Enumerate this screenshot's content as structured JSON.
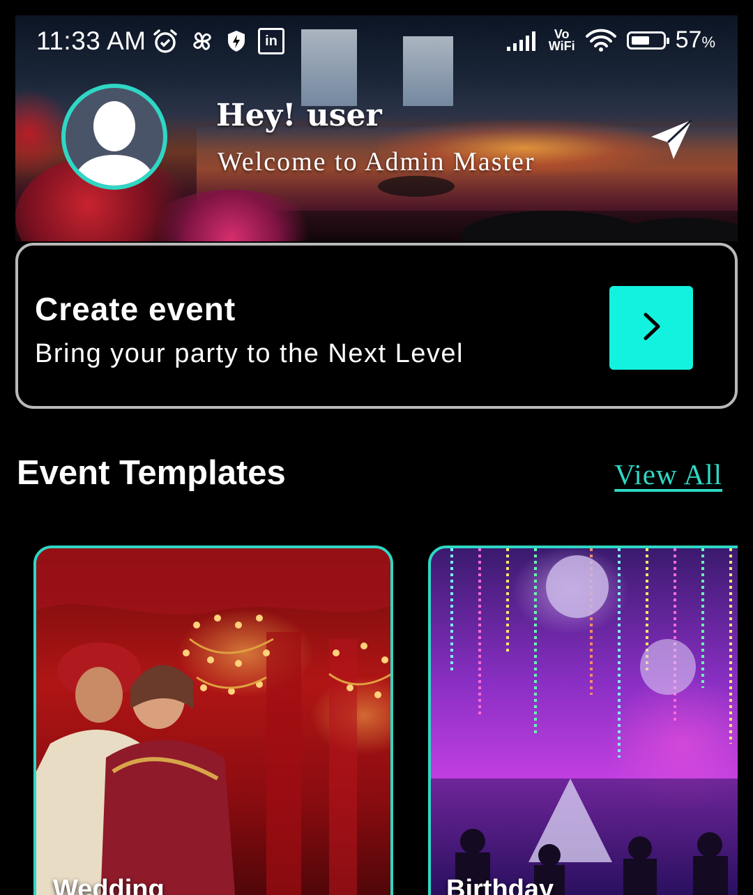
{
  "status_bar": {
    "time": "11:33 AM",
    "left_icons": [
      "alarm-icon",
      "pinwheel-icon",
      "shield-icon",
      "linkedin-icon"
    ],
    "right_icons": [
      "signal-icon",
      "vowifi-icon",
      "wifi-icon",
      "battery-icon"
    ],
    "vowifi_top": "Vo",
    "vowifi_bottom": "WiFi",
    "linkedin_text": "in",
    "battery_level": 0.57,
    "battery_value": "57",
    "battery_unit": "%"
  },
  "header": {
    "greeting": "Hey! user",
    "welcome": "Welcome to Admin Master",
    "avatar_icon": "user-avatar-icon",
    "action_icon": "send-icon"
  },
  "create_event": {
    "title": "Create event",
    "subtitle": "Bring your party to the Next Level",
    "button_icon": "chevron-right-icon",
    "accent": "#13f2de"
  },
  "templates": {
    "title": "Event Templates",
    "view_all": "View All",
    "items": [
      {
        "label": "Wedding"
      },
      {
        "label": "Birthday"
      }
    ]
  },
  "theme": {
    "background": "#000000",
    "accent": "#2fd7c4",
    "card_border": "#b9b9b9"
  }
}
